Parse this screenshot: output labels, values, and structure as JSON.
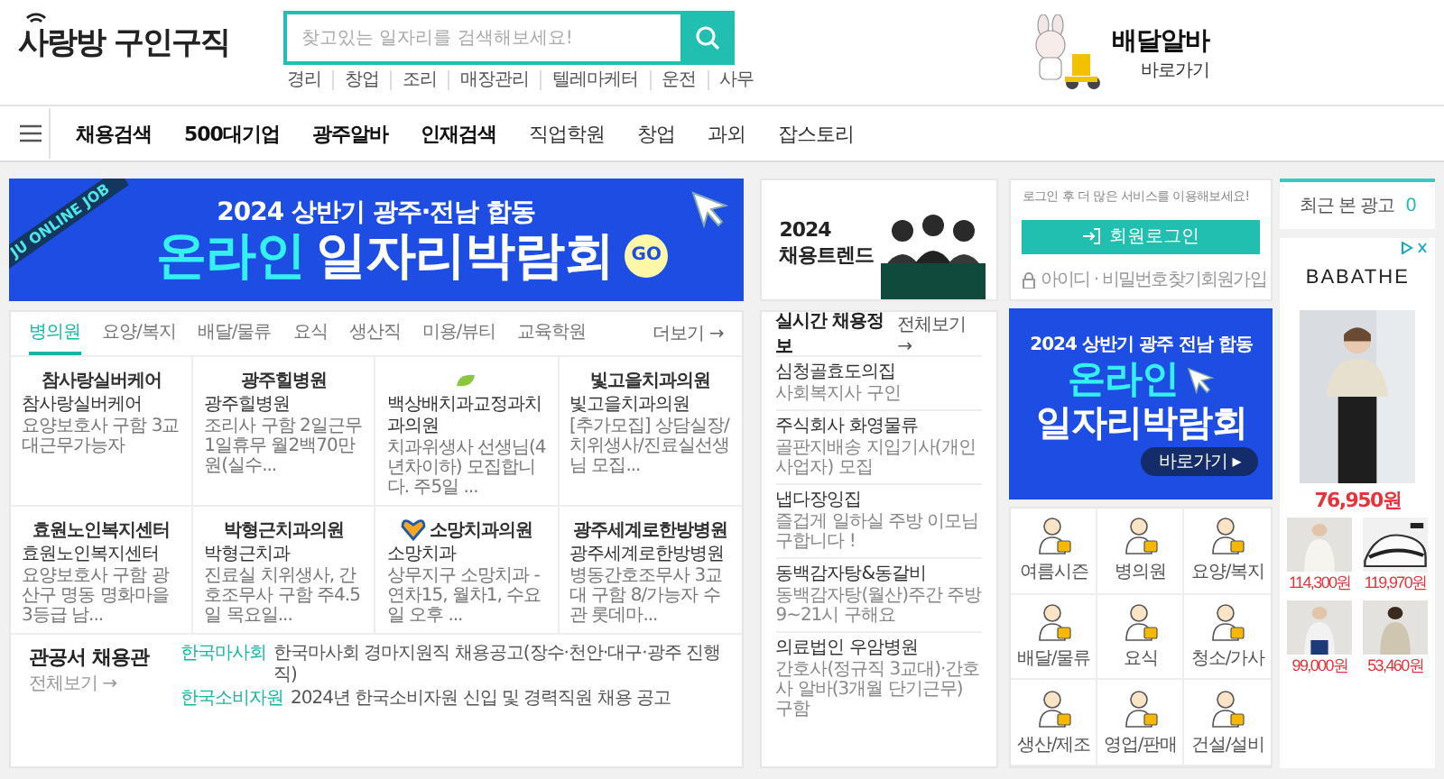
{
  "header": {
    "logo": "사랑방 구인구직",
    "search": {
      "placeholder": "찾고있는 일자리를 검색해보세요!"
    },
    "quick_links": [
      "경리",
      "창업",
      "조리",
      "매장관리",
      "텔레마케터",
      "운전",
      "사무"
    ],
    "promo": {
      "title": "배달알바",
      "link": "바로가기"
    }
  },
  "nav": {
    "items": [
      {
        "label": "채용검색",
        "kind": "strong"
      },
      {
        "label": "500대기업",
        "kind": "strong"
      },
      {
        "label": "광주알바",
        "kind": "strong"
      },
      {
        "label": "인재검색",
        "kind": "strong"
      },
      {
        "label": "직업학원",
        "kind": "normal"
      },
      {
        "label": "창업",
        "kind": "normal"
      },
      {
        "label": "과외",
        "kind": "normal"
      },
      {
        "label": "잡스토리",
        "kind": "normal"
      }
    ]
  },
  "banner": {
    "ribbon": "JU ONLINE JOB",
    "subtitle": "2024 상반기 광주·전남 합동",
    "highlight": "온라인",
    "title": "일자리박람회",
    "button": "GO"
  },
  "jobs": {
    "tabs": [
      {
        "label": "병의원",
        "selected": true
      },
      {
        "label": "요양/복지",
        "selected": false
      },
      {
        "label": "배달/물류",
        "selected": false
      },
      {
        "label": "요식",
        "selected": false
      },
      {
        "label": "생산직",
        "selected": false
      },
      {
        "label": "미용/뷰티",
        "selected": false
      },
      {
        "label": "교육학원",
        "selected": false
      }
    ],
    "more": "더보기 →",
    "cards": [
      {
        "kind": "text",
        "logo": "참사랑실버케어",
        "company": "참사랑실버케어",
        "desc": "요양보호사 구함 3교대근무가능자"
      },
      {
        "kind": "text",
        "logo": "광주힐병원",
        "company": "광주힐병원",
        "desc": "조리사 구함 2일근무 1일휴무 월2백70만원(실수..."
      },
      {
        "kind": "mark",
        "company": "백상배치과교정과치과의원",
        "desc": "치과위생사 선생님(4년차이하) 모집합니다. 주5일 ..."
      },
      {
        "kind": "text",
        "logo": "빛고을치과의원",
        "company": "빛고을치과의원",
        "desc": "[추가모집] 상담실장/치위생사/진료실선생님 모집..."
      },
      {
        "kind": "text",
        "logo": "효원노인복지센터",
        "company": "효원노인복지센터",
        "desc": "요양보호사 구함 광산구 명동 명화마을 3등급 남..."
      },
      {
        "kind": "text",
        "logo": "박형근치과의원",
        "company": "박형근치과",
        "desc": "진료실 치위생사, 간호조무사 구함 주4.5일 목요일..."
      },
      {
        "kind": "mark_text",
        "logo": "소망치과의원",
        "company": "소망치과",
        "desc": "상무지구 소망치과 - 연차15, 월차1, 수요일 오후 ..."
      },
      {
        "kind": "text",
        "logo": "광주세계로한방병원",
        "company": "광주세계로한방병원",
        "desc": "병동간호조무사 3교대 구함 8/가능자 수관 롯데마..."
      }
    ]
  },
  "gov": {
    "title": "관공서 채용관",
    "more": "전체보기 →",
    "items": [
      {
        "org": "한국마사회",
        "text": "한국마사회 경마지원직 채용공고(장수·천안·대구·광주 진행직)"
      },
      {
        "org": "한국소비자원",
        "text": "2024년 한국소비자원 신입 및 경력직원 채용 공고"
      }
    ]
  },
  "trend": {
    "year": "2024",
    "title": "채용트렌드"
  },
  "realtime": {
    "title": "실시간 채용정보",
    "more": "전체보기 →",
    "items": [
      {
        "company": "심청골효도의집",
        "desc": "사회복지사 구인"
      },
      {
        "company": "주식회사 화영물류",
        "desc": "골판지배송 지입기사(개인사업자) 모집"
      },
      {
        "company": "냅다장잉집",
        "desc": "즐겁게 일하실 주방 이모님 구합니다 !"
      },
      {
        "company": "동백감자탕&동갈비",
        "desc": "동백감자탕(월산)주간 주방 9~21시 구해요"
      },
      {
        "company": "의료법인 우암병원",
        "desc": "간호사(정규직 3교대)·간호사 알바(3개월 단기근무) 구함"
      }
    ]
  },
  "login": {
    "message": "로그인 후 더 많은 서비스를 이용해보세요!",
    "button": "회원로그인",
    "find": "아이디 · 비밀번호찾기",
    "join": "회원가입"
  },
  "side_banner": {
    "subtitle": "2024 상반기 광주 전남 합동",
    "highlight": "온라인",
    "title": "일자리박람회",
    "button": "바로가기 ▸"
  },
  "categories": [
    "여름시즌",
    "병의원",
    "요양/복지",
    "배달/물류",
    "요식",
    "청소/가사",
    "생산/제조",
    "영업/판매",
    "건설/설비"
  ],
  "recent_ads": {
    "label": "최근 본 광고",
    "count": "0"
  },
  "ad": {
    "brand": "BABATHE",
    "main_price": "76,950원",
    "products": [
      {
        "price": "114,300원"
      },
      {
        "price": "119,970원"
      },
      {
        "price": "99,000원"
      },
      {
        "price": "53,460원"
      }
    ]
  }
}
